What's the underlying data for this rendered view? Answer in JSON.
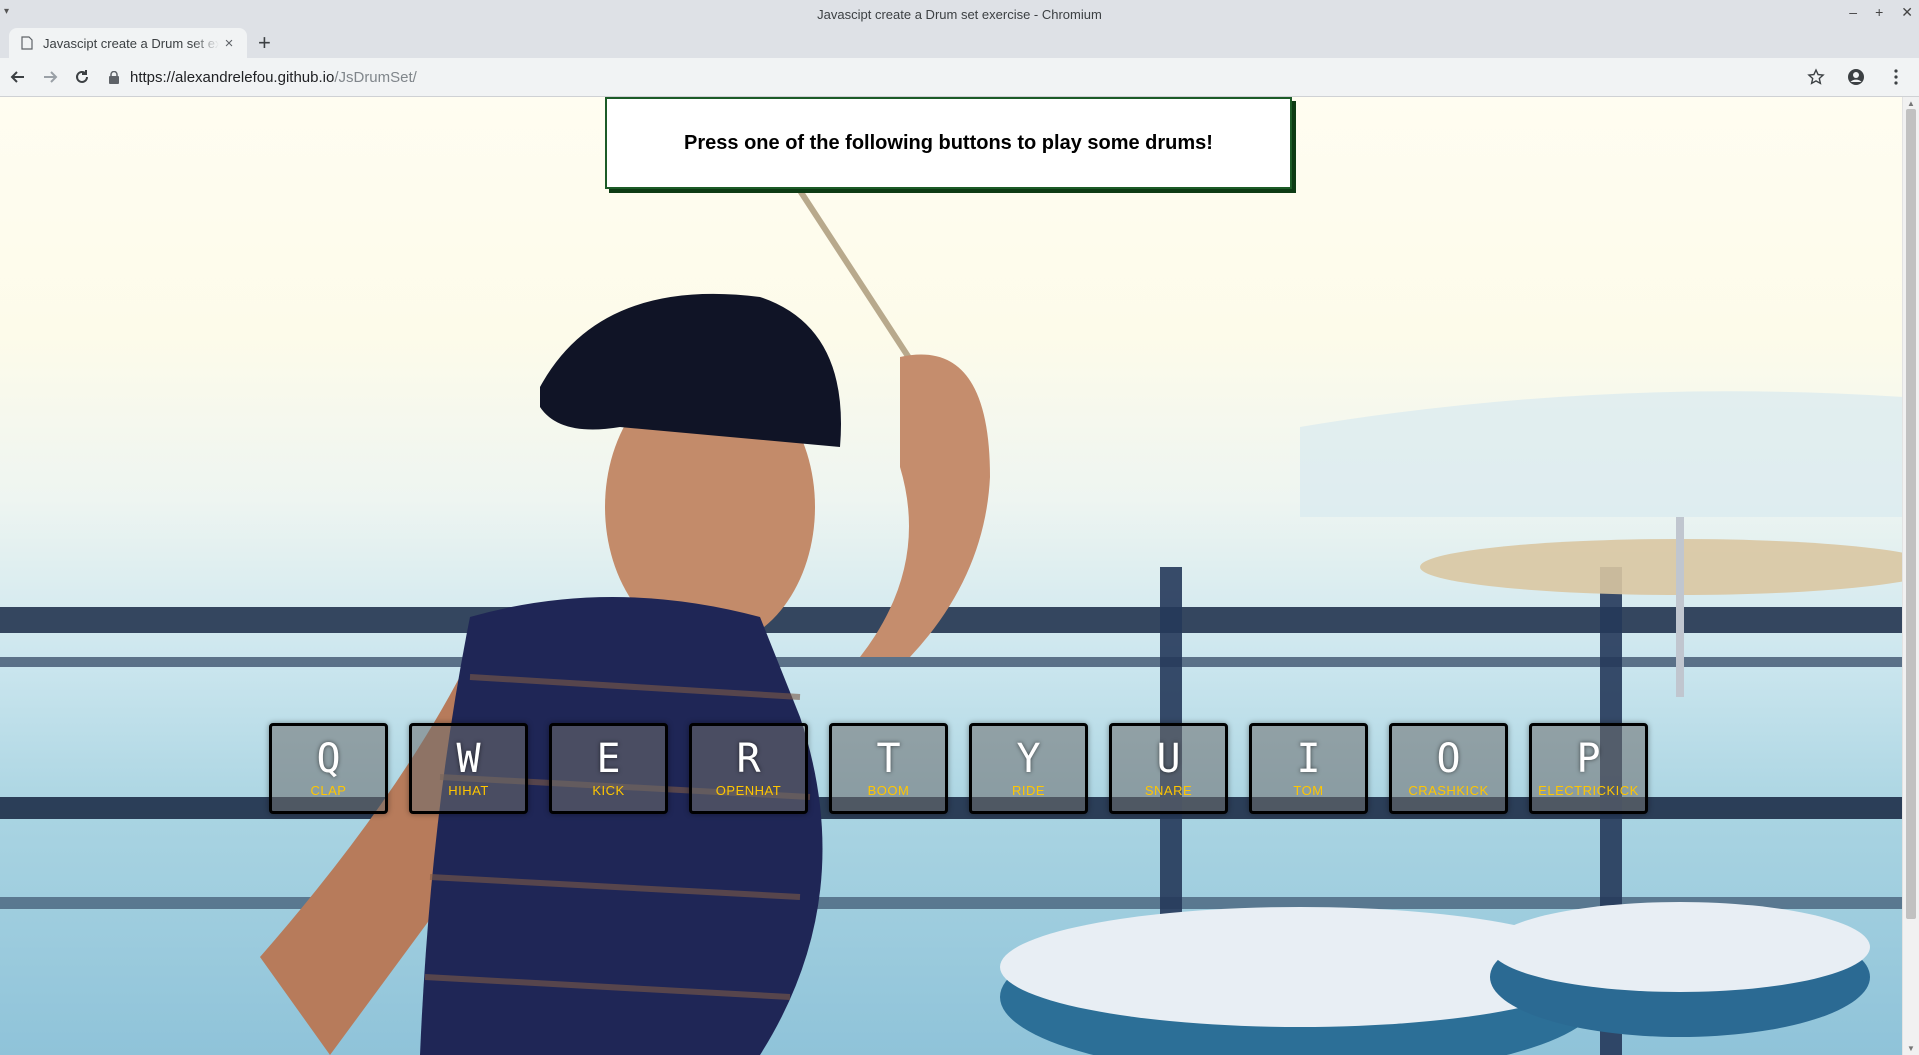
{
  "window": {
    "title": "Javascipt create a Drum set exercise - Chromium",
    "controls": [
      "–",
      "+",
      "✕"
    ]
  },
  "tab": {
    "title": "Javascipt create a Drum set exercise",
    "close": "×"
  },
  "newtab": "+",
  "address": {
    "host": "https://alexandrelefou.github.io",
    "path": "/JsDrumSet/"
  },
  "page": {
    "heading": "Press one of the following buttons to play some drums!",
    "keys": [
      {
        "key": "Q",
        "sound": "CLAP"
      },
      {
        "key": "W",
        "sound": "HIHAT"
      },
      {
        "key": "E",
        "sound": "KICK"
      },
      {
        "key": "R",
        "sound": "OPENHAT"
      },
      {
        "key": "T",
        "sound": "BOOM"
      },
      {
        "key": "Y",
        "sound": "RIDE"
      },
      {
        "key": "U",
        "sound": "SNARE"
      },
      {
        "key": "I",
        "sound": "TOM"
      },
      {
        "key": "O",
        "sound": "CRASHKICK"
      },
      {
        "key": "P",
        "sound": "ELECTRICKICK"
      }
    ]
  },
  "colors": {
    "header_border": "#1c5b27",
    "sound_label": "#ffc600"
  }
}
